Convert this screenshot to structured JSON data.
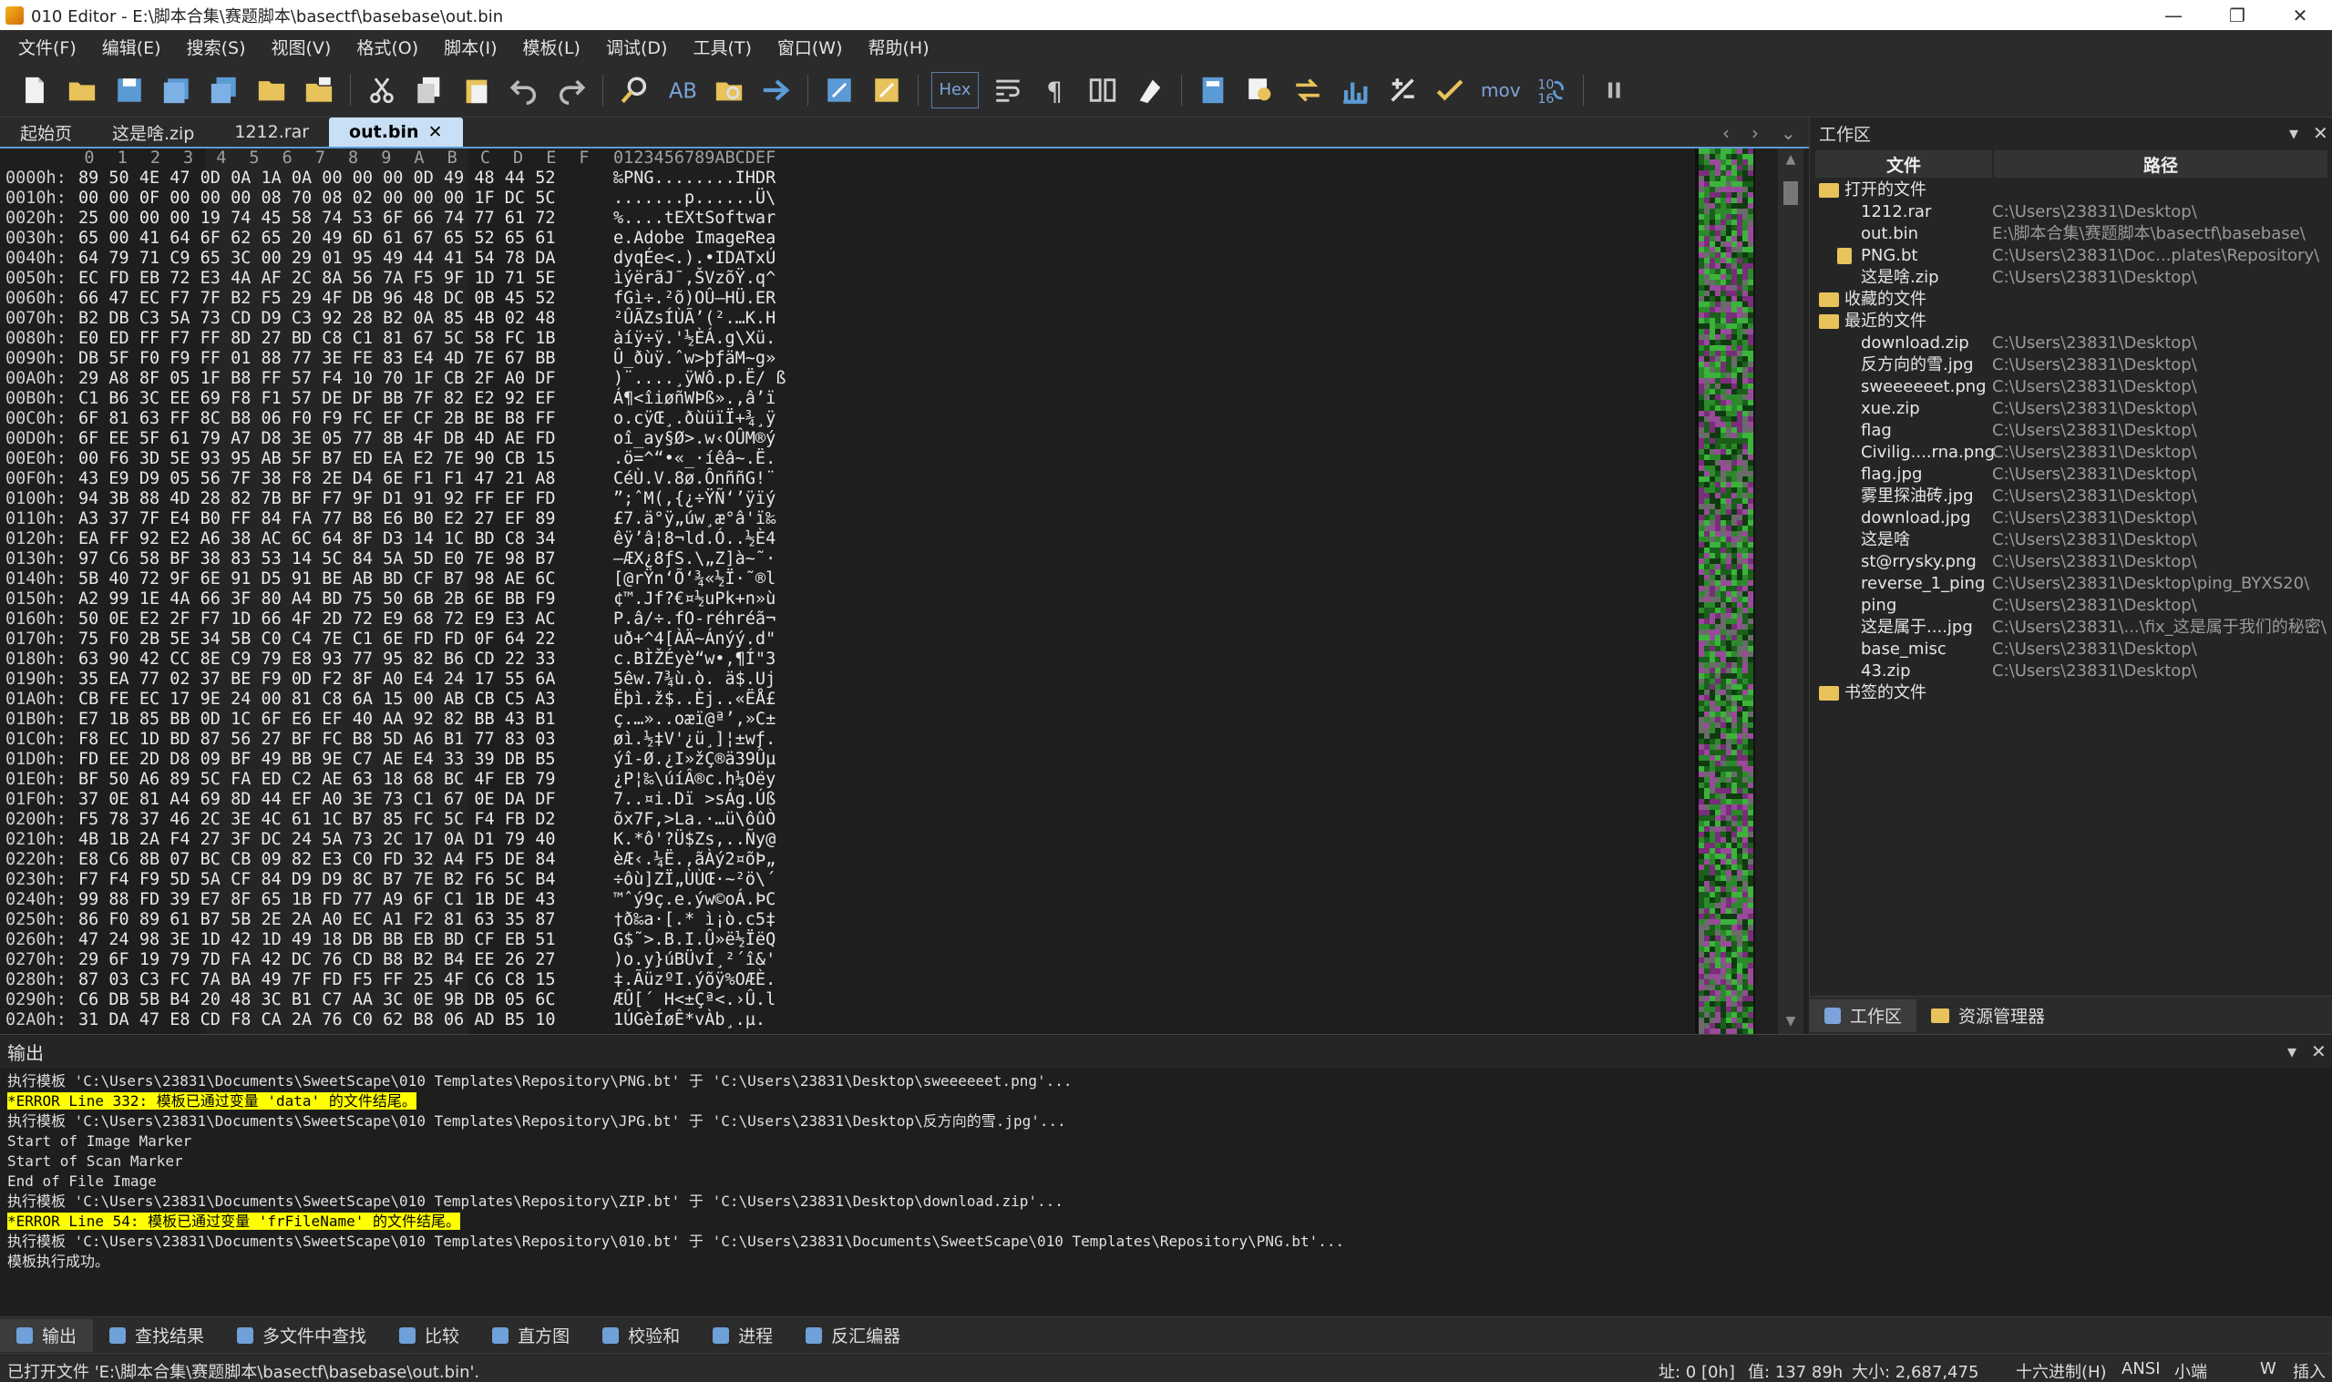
{
  "window": {
    "title": "010 Editor - E:\\脚本合集\\赛题脚本\\basectf\\basebase\\out.bin",
    "minimize": "—",
    "maximize": "❐",
    "close": "✕"
  },
  "menu": [
    "文件(F)",
    "编辑(E)",
    "搜索(S)",
    "视图(V)",
    "格式(O)",
    "脚本(I)",
    "模板(L)",
    "调试(D)",
    "工具(T)",
    "窗口(W)",
    "帮助(H)"
  ],
  "toolbar": {
    "hex_label": "Hex",
    "mov_label": "mov"
  },
  "tabs": [
    {
      "label": "起始页",
      "active": false
    },
    {
      "label": "这是啥.zip",
      "active": false
    },
    {
      "label": "1212.rar",
      "active": false
    },
    {
      "label": "out.bin",
      "active": true,
      "close": "✕"
    }
  ],
  "tab_nav": {
    "prev": "‹",
    "next": "›",
    "down": "⌄"
  },
  "hex": {
    "column_headers": [
      "0",
      "1",
      "2",
      "3",
      "4",
      "5",
      "6",
      "7",
      "8",
      "9",
      "A",
      "B",
      "C",
      "D",
      "E",
      "F"
    ],
    "ascii_header": "0123456789ABCDEF",
    "rows": [
      {
        "addr": "0000h:",
        "bytes": "89 50 4E 47 0D 0A 1A 0A 00 00 00 0D 49 48 44 52",
        "ascii": "‰PNG........IHDR"
      },
      {
        "addr": "0010h:",
        "bytes": "00 00 0F 00 00 00 08 70 08 02 00 00 00 1F DC 5C",
        "ascii": ".......p......Ü\\"
      },
      {
        "addr": "0020h:",
        "bytes": "25 00 00 00 19 74 45 58 74 53 6F 66 74 77 61 72",
        "ascii": "%....tEXtSoftwar"
      },
      {
        "addr": "0030h:",
        "bytes": "65 00 41 64 6F 62 65 20 49 6D 61 67 65 52 65 61",
        "ascii": "e.Adobe ImageRea"
      },
      {
        "addr": "0040h:",
        "bytes": "64 79 71 C9 65 3C 00 29 01 95 49 44 41 54 78 DA",
        "ascii": "dyqÉe<.).•IDATxÚ"
      },
      {
        "addr": "0050h:",
        "bytes": "EC FD EB 72 E3 4A AF 2C 8A 56 7A F5 9F 1D 71 5E",
        "ascii": "ìýërãJ¯,ŠVzõŸ.q^"
      },
      {
        "addr": "0060h:",
        "bytes": "66 47 EC F7 7F B2 F5 29 4F DB 96 48 DC 0B 45 52",
        "ascii": "fGì÷.²õ)OÛ–HÜ.ER"
      },
      {
        "addr": "0070h:",
        "bytes": "B2 DB C3 5A 73 CD D9 C3 92 28 B2 0A 85 4B 02 48",
        "ascii": "²ÛÃZsÍÙÃ’(².…K.H"
      },
      {
        "addr": "0080h:",
        "bytes": "E0 ED FF F7 FF 8D 27 BD C8 C1 81 67 5C 58 FC 1B",
        "ascii": "àíÿ÷ÿ.'½ÈÁ.g\\Xü."
      },
      {
        "addr": "0090h:",
        "bytes": "DB 5F F0 F9 FF 01 88 77 3E FE 83 E4 4D 7E 67 BB",
        "ascii": "Û_ðùÿ.ˆw>þƒäM~g»"
      },
      {
        "addr": "00A0h:",
        "bytes": "29 A8 8F 05 1F B8 FF 57 F4 10 70 1F CB 2F A0 DF",
        "ascii": ")¨....¸ÿWô.p.Ë/ ß"
      },
      {
        "addr": "00B0h:",
        "bytes": "C1 B6 3C EE 69 F8 F1 57 DE DF BB 7F 82 E2 92 EF",
        "ascii": "Á¶<îiøñWÞß».‚â’ï"
      },
      {
        "addr": "00C0h:",
        "bytes": "6F 81 63 FF 8C B8 06 F0 F9 FC EF CF 2B BE B8 FF",
        "ascii": "o.cÿŒ¸.ðùüïÏ+¾¸ÿ"
      },
      {
        "addr": "00D0h:",
        "bytes": "6F EE 5F 61 79 A7 D8 3E 05 77 8B 4F DB 4D AE FD",
        "ascii": "oî_ay§Ø>.w‹OÛM®ý"
      },
      {
        "addr": "00E0h:",
        "bytes": "00 F6 3D 5E 93 95 AB 5F B7 ED EA E2 7E 90 CB 15",
        "ascii": ".ö=^“•«_·íêâ~.Ë."
      },
      {
        "addr": "00F0h:",
        "bytes": "43 E9 D9 05 56 7F 38 F8 2E D4 6E F1 F1 47 21 A8",
        "ascii": "CéÙ.V.8ø.ÔnññG!¨"
      },
      {
        "addr": "0100h:",
        "bytes": "94 3B 88 4D 28 82 7B BF F7 9F D1 91 92 FF EF FD",
        "ascii": "”;ˆM(‚{¿÷ŸÑ‘’ÿïý"
      },
      {
        "addr": "0110h:",
        "bytes": "A3 37 7F E4 B0 FF 84 FA 77 B8 E6 B0 E2 27 EF 89",
        "ascii": "£7.ä°ÿ„úw¸æ°â'ï‰"
      },
      {
        "addr": "0120h:",
        "bytes": "EA FF 92 E2 A6 38 AC 6C 64 8F D3 14 1C BD C8 34",
        "ascii": "êÿ’â¦8¬ld.Ó..½È4"
      },
      {
        "addr": "0130h:",
        "bytes": "97 C6 58 BF 38 83 53 14 5C 84 5A 5D E0 7E 98 B7",
        "ascii": "—ÆX¿8ƒS.\\„Z]à~˜·"
      },
      {
        "addr": "0140h:",
        "bytes": "5B 40 72 9F 6E 91 D5 91 BE AB BD CF B7 98 AE 6C",
        "ascii": "[@rŸn‘Õ‘¾«½Ï·˜®l"
      },
      {
        "addr": "0150h:",
        "bytes": "A2 99 1E 4A 66 3F 80 A4 BD 75 50 6B 2B 6E BB F9",
        "ascii": "¢™.Jf?€¤½uPk+n»ù"
      },
      {
        "addr": "0160h:",
        "bytes": "50 0E E2 2F F7 1D 66 4F 2D 72 E9 68 72 E9 E3 AC",
        "ascii": "P.â/÷.fO-réhréã¬"
      },
      {
        "addr": "0170h:",
        "bytes": "75 F0 2B 5E 34 5B C0 C4 7E C1 6E FD FD 0F 64 22",
        "ascii": "uð+^4[ÀÄ~Ánýý.d\""
      },
      {
        "addr": "0180h:",
        "bytes": "63 90 42 CC 8E C9 79 E8 93 77 95 82 B6 CD 22 33",
        "ascii": "c.BÌŽÉyè“w•‚¶Í\"3"
      },
      {
        "addr": "0190h:",
        "bytes": "35 EA 77 02 37 BE F9 0D F2 8F A0 E4 24 17 55 6A",
        "ascii": "5êw.7¾ù.ò. ä$.Uj"
      },
      {
        "addr": "01A0h:",
        "bytes": "CB FE EC 17 9E 24 00 81 C8 6A 15 00 AB CB C5 A3",
        "ascii": "Ëþì.ž$..Èj..«ËÅ£"
      },
      {
        "addr": "01B0h:",
        "bytes": "E7 1B 85 BB 0D 1C 6F E6 EF 40 AA 92 82 BB 43 B1",
        "ascii": "ç.…»..oæï@ª’‚»C±"
      },
      {
        "addr": "01C0h:",
        "bytes": "F8 EC 1D BD 87 56 27 BF FC B8 5D A6 B1 77 83 03",
        "ascii": "øì.½‡V'¿ü¸]¦±wƒ."
      },
      {
        "addr": "01D0h:",
        "bytes": "FD EE 2D D8 09 BF 49 BB 9E C7 AE E4 33 39 DB B5",
        "ascii": "ýî-Ø.¿I»žÇ®ä39Ûµ"
      },
      {
        "addr": "01E0h:",
        "bytes": "BF 50 A6 89 5C FA ED C2 AE 63 18 68 BC 4F EB 79",
        "ascii": "¿P¦‰\\úíÂ®c.h¼Oëy"
      },
      {
        "addr": "01F0h:",
        "bytes": "37 0E 81 A4 69 8D 44 EF A0 3E 73 C1 67 0E DA DF",
        "ascii": "7..¤i.Dï >sÁg.Úß"
      },
      {
        "addr": "0200h:",
        "bytes": "F5 78 37 46 2C 3E 4C 61 1C B7 85 FC 5C F4 FB D2",
        "ascii": "õx7F,>La.·…ü\\ôûÒ"
      },
      {
        "addr": "0210h:",
        "bytes": "4B 1B 2A F4 27 3F DC 24 5A 73 2C 17 0A D1 79 40",
        "ascii": "K.*ô'?Ü$Zs,..Ñy@"
      },
      {
        "addr": "0220h:",
        "bytes": "E8 C6 8B 07 BC CB 09 82 E3 C0 FD 32 A4 F5 DE 84",
        "ascii": "èÆ‹.¼Ë.‚ãÀý2¤õÞ„"
      },
      {
        "addr": "0230h:",
        "bytes": "F7 F4 F9 5D 5A CF 84 D9 D9 8C B7 7E B2 F6 5C B4",
        "ascii": "÷ôù]ZÏ„ÙÙŒ·~²ö\\´"
      },
      {
        "addr": "0240h:",
        "bytes": "99 88 FD 39 E7 8F 65 1B FD 77 A9 6F C1 1B DE 43",
        "ascii": "™ˆý9ç.e.ýw©oÁ.ÞC"
      },
      {
        "addr": "0250h:",
        "bytes": "86 F0 89 61 B7 5B 2E 2A A0 EC A1 F2 81 63 35 87",
        "ascii": "†ð‰a·[.* ì¡ò.c5‡"
      },
      {
        "addr": "0260h:",
        "bytes": "47 24 98 3E 1D 42 1D 49 18 DB BB EB BD CF EB 51",
        "ascii": "G$˜>.B.I.Û»ë½ÏëQ"
      },
      {
        "addr": "0270h:",
        "bytes": "29 6F 19 79 7D FA 42 DC 76 CD B8 B2 B4 EE 26 27",
        "ascii": ")o.y}úBÜvÍ¸²´î&'"
      },
      {
        "addr": "0280h:",
        "bytes": "87 03 C3 FC 7A BA 49 7F FD F5 FF 25 4F C6 C8 15",
        "ascii": "‡.ÃüzºI.ýõÿ%OÆÈ."
      },
      {
        "addr": "0290h:",
        "bytes": "C6 DB 5B B4 20 48 3C B1 C7 AA 3C 0E 9B DB 05 6C",
        "ascii": "ÆÛ[´ H<±Çª<.›Û.l"
      },
      {
        "addr": "02A0h:",
        "bytes": "31 DA 47 E8 CD F8 CA 2A 76 C0 62 B8 06 AD B5 10",
        "ascii": "1ÚGèÍøÊ*vÀb¸.­µ."
      }
    ]
  },
  "workspace": {
    "title": "工作区",
    "col_file": "文件",
    "col_path": "路径",
    "groups": [
      {
        "label": "打开的文件",
        "items": [
          {
            "name": "1212.rar",
            "path": "C:\\Users\\23831\\Desktop\\"
          },
          {
            "name": "out.bin",
            "path": "E:\\脚本合集\\赛题脚本\\basectf\\basebase\\"
          },
          {
            "name": "PNG.bt",
            "path": "C:\\Users\\23831\\Doc...plates\\Repository\\"
          },
          {
            "name": "这是啥.zip",
            "path": "C:\\Users\\23831\\Desktop\\"
          }
        ]
      },
      {
        "label": "收藏的文件",
        "items": []
      },
      {
        "label": "最近的文件",
        "items": [
          {
            "name": "download.zip",
            "path": "C:\\Users\\23831\\Desktop\\"
          },
          {
            "name": "反方向的雪.jpg",
            "path": "C:\\Users\\23831\\Desktop\\"
          },
          {
            "name": "sweeeeeet.png",
            "path": "C:\\Users\\23831\\Desktop\\"
          },
          {
            "name": "xue.zip",
            "path": "C:\\Users\\23831\\Desktop\\"
          },
          {
            "name": "flag",
            "path": "C:\\Users\\23831\\Desktop\\"
          },
          {
            "name": "Civilig....rna.png",
            "path": "C:\\Users\\23831\\Desktop\\"
          },
          {
            "name": "flag.jpg",
            "path": "C:\\Users\\23831\\Desktop\\"
          },
          {
            "name": "雾里探油砖.jpg",
            "path": "C:\\Users\\23831\\Desktop\\"
          },
          {
            "name": "download.jpg",
            "path": "C:\\Users\\23831\\Desktop\\"
          },
          {
            "name": "这是啥",
            "path": "C:\\Users\\23831\\Desktop\\"
          },
          {
            "name": "st@rrysky.png",
            "path": "C:\\Users\\23831\\Desktop\\"
          },
          {
            "name": "reverse_1_ping",
            "path": "C:\\Users\\23831\\Desktop\\ping_BYXS20\\"
          },
          {
            "name": "ping",
            "path": "C:\\Users\\23831\\Desktop\\"
          },
          {
            "name": "这是属于....jpg",
            "path": "C:\\Users\\23831\\...\\fix_这是属于我们的秘密\\"
          },
          {
            "name": "base_misc",
            "path": "C:\\Users\\23831\\Desktop\\"
          },
          {
            "name": "43.zip",
            "path": "C:\\Users\\23831\\Desktop\\"
          }
        ]
      },
      {
        "label": "书签的文件",
        "items": []
      }
    ],
    "tab_workspace": "工作区",
    "tab_explorer": "资源管理器"
  },
  "output": {
    "title": "输出",
    "lines": [
      {
        "text": "执行模板 'C:\\Users\\23831\\Documents\\SweetScape\\010 Templates\\Repository\\PNG.bt' 于 'C:\\Users\\23831\\Desktop\\sweeeeeet.png'...",
        "error": false
      },
      {
        "text": "*ERROR Line 332: 模板已通过变量 'data' 的文件结尾。",
        "error": true
      },
      {
        "text": "执行模板 'C:\\Users\\23831\\Documents\\SweetScape\\010 Templates\\Repository\\JPG.bt' 于 'C:\\Users\\23831\\Desktop\\反方向的雪.jpg'...",
        "error": false
      },
      {
        "text": "Start of Image Marker",
        "error": false
      },
      {
        "text": "Start of Scan Marker",
        "error": false
      },
      {
        "text": "End of File Image",
        "error": false
      },
      {
        "text": "执行模板 'C:\\Users\\23831\\Documents\\SweetScape\\010 Templates\\Repository\\ZIP.bt' 于 'C:\\Users\\23831\\Desktop\\download.zip'...",
        "error": false
      },
      {
        "text": "*ERROR Line 54: 模板已通过变量 'frFileName' 的文件结尾。",
        "error": true
      },
      {
        "text": "执行模板 'C:\\Users\\23831\\Documents\\SweetScape\\010 Templates\\Repository\\010.bt' 于 'C:\\Users\\23831\\Documents\\SweetScape\\010 Templates\\Repository\\PNG.bt'...",
        "error": false
      },
      {
        "text": "模板执行成功。",
        "error": false
      }
    ]
  },
  "bottom_tabs": [
    "输出",
    "查找结果",
    "多文件中查找",
    "比较",
    "直方图",
    "校验和",
    "进程",
    "反汇编器"
  ],
  "status": {
    "message": "已打开文件 'E:\\脚本合集\\赛题脚本\\basectf\\basebase\\out.bin'.",
    "address": "址: 0 [0h]",
    "value": "值: 137 89h",
    "size": "大小: 2,687,475",
    "mode": "十六进制(H)",
    "encoding": "ANSI",
    "endian": "小端",
    "w": "W",
    "insert": "插入"
  },
  "colors": {
    "accent": "#5b9bd5",
    "error_highlight": "#ffff00",
    "active_tab": "#c9dff5"
  }
}
